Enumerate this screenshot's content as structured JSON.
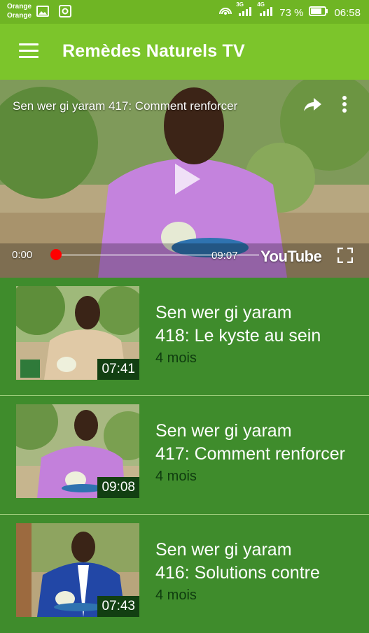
{
  "status_bar": {
    "carrier_line1": "Orange",
    "carrier_line2": "Orange",
    "battery": "73 %",
    "time": "06:58",
    "net1": "3G",
    "net2": "4G"
  },
  "app_bar": {
    "title": "Remèdes Naturels TV",
    "menu_icon": "hamburger-menu-icon"
  },
  "player": {
    "title": "Sen wer gi yaram 417: Comment renforcer",
    "current_time": "0:00",
    "duration": "09:07",
    "progress": 0,
    "brand": "YouTube",
    "icons": [
      "share-icon",
      "more-vert-icon",
      "play-icon",
      "fullscreen-icon"
    ]
  },
  "videos": [
    {
      "title_line1": "Sen wer gi yaram",
      "title_line2": "418: Le kyste au sein",
      "duration": "07:41",
      "age": "4 mois"
    },
    {
      "title_line1": "Sen wer gi yaram",
      "title_line2": "417: Comment renforcer",
      "duration": "09:08",
      "age": "4 mois"
    },
    {
      "title_line1": "Sen wer gi yaram",
      "title_line2": "416: Solutions contre",
      "duration": "07:43",
      "age": "4 mois"
    }
  ],
  "colors": {
    "status_bar": "#6fb524",
    "app_bar": "#7cc52b",
    "list_background": "#3f8c2c",
    "age_text": "#0f3c0f",
    "duration_badge": "#123f12"
  }
}
